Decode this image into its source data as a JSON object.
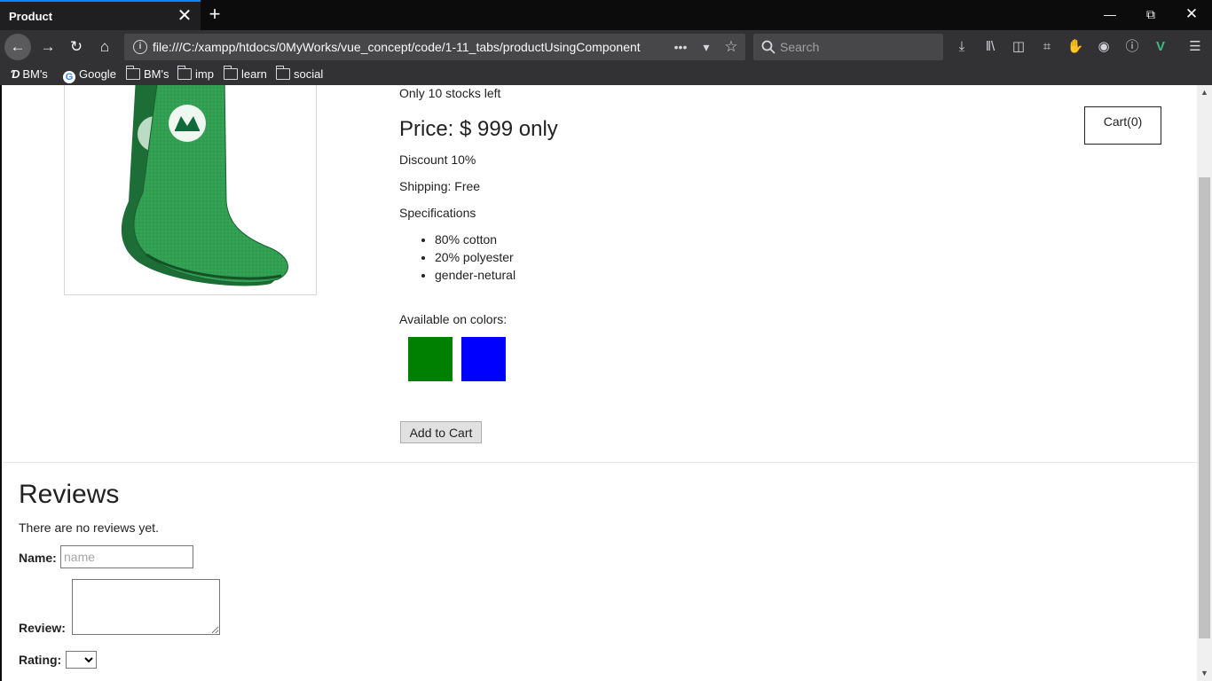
{
  "browser": {
    "tab_title": "Product",
    "tab_close": "✕",
    "new_tab": "+",
    "url": "file:///C:/xampp/htdocs/0MyWorks/vue_concept/code/1-11_tabs/productUsingComponent",
    "search_placeholder": "Search",
    "bookmarks": [
      "BM's",
      "Google",
      "BM's",
      "imp",
      "learn",
      "social"
    ]
  },
  "product": {
    "stock_text": "Only 10 stocks left",
    "price": "Price: $ 999 only",
    "discount": "Discount 10%",
    "shipping": "Shipping: Free",
    "specifications_heading": "Specifications",
    "specifications": [
      "80% cotton",
      "20% polyester",
      "gender-netural"
    ],
    "colors_heading": "Available on colors:",
    "colors": [
      "#008000",
      "#0000ff"
    ],
    "add_to_cart": "Add to Cart",
    "cart": "Cart(0)"
  },
  "reviews": {
    "heading": "Reviews",
    "empty_text": "There are no reviews yet.",
    "name_label": "Name:",
    "name_placeholder": "name",
    "review_label": "Review:",
    "rating_label": "Rating:"
  },
  "scroll": {
    "position": 0.2
  }
}
